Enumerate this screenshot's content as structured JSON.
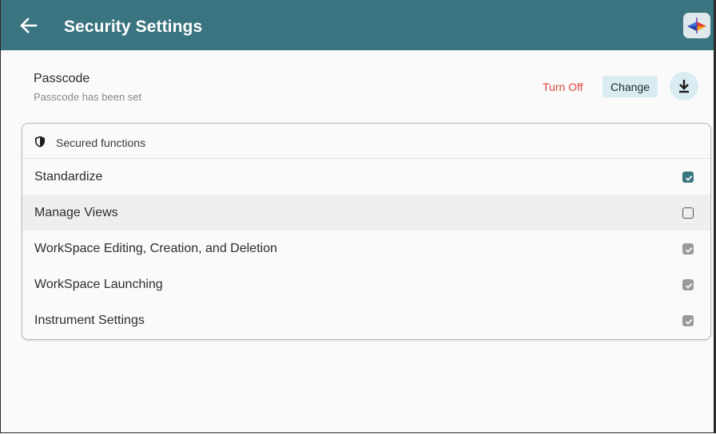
{
  "header": {
    "title": "Security Settings",
    "back_icon": "arrow-left-icon",
    "logo_icon": "app-logo-icon",
    "color": "#3a7480"
  },
  "passcode": {
    "title": "Passcode",
    "subtitle": "Passcode has been set",
    "turn_off_label": "Turn Off",
    "change_label": "Change",
    "download_icon": "download-icon",
    "turn_off_color": "#e2463d"
  },
  "secured": {
    "header_label": "Secured functions",
    "header_icon": "shield-icon",
    "items": [
      {
        "label": "Standardize",
        "state": "checked"
      },
      {
        "label": "Manage Views",
        "state": "unchecked"
      },
      {
        "label": "WorkSpace Editing, Creation, and Deletion",
        "state": "checked-disabled"
      },
      {
        "label": "WorkSpace Launching",
        "state": "checked-disabled"
      },
      {
        "label": "Instrument Settings",
        "state": "checked-disabled"
      }
    ]
  }
}
